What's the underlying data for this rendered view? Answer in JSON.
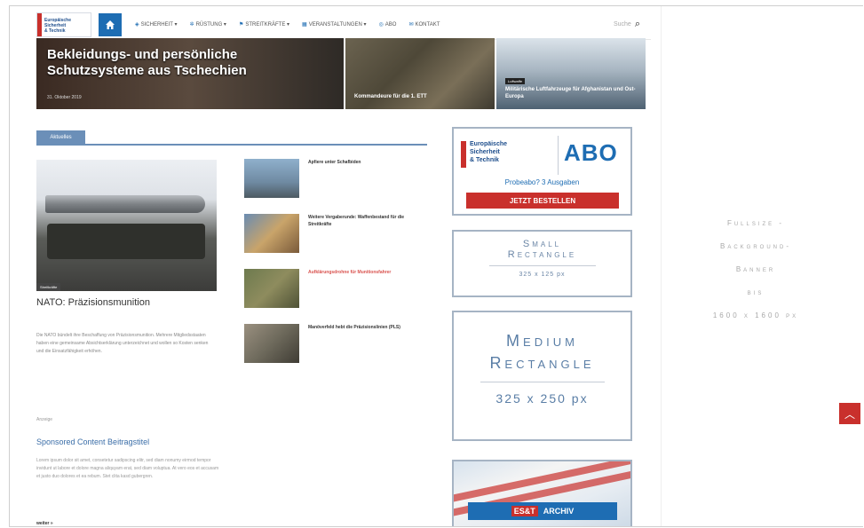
{
  "nav": {
    "logo_lines": [
      "Europäische",
      "Sicherheit",
      "& Technik"
    ],
    "items": [
      {
        "label": "Sicherheit",
        "icon": "shield-icon"
      },
      {
        "label": "Rüstung",
        "icon": "gear-icon"
      },
      {
        "label": "Streitkräfte",
        "icon": "flag-icon"
      },
      {
        "label": "Veranstaltungen",
        "icon": "calendar-icon"
      },
      {
        "label": "Abo",
        "icon": "cart-icon"
      },
      {
        "label": "Kontakt",
        "icon": "mail-icon"
      }
    ],
    "search_placeholder": "Suche"
  },
  "hero": {
    "main_title": "Bekleidungs- und persönliche Schutzsysteme aus Tschechien",
    "main_date": "31. Oktober 2019",
    "card1": {
      "tag": "",
      "label": "Kommandeure für die 1. ETT"
    },
    "card2": {
      "tag": "Luftwaffe",
      "label": "Militärische Luftfahrzeuge für Afghanistan und Ost-Europa"
    }
  },
  "section": {
    "tab_label": "Aktuelles"
  },
  "featured": {
    "badge": "Streitkräfte",
    "title": "NATO: Präzisionsmunition",
    "text": "Die NATO bündelt ihre Beschaffung von Präzisionsmunition. Mehrere Mitgliedsstaaten haben eine gemeinsame Absichtserklärung unterzeichnet und wollen so Kosten senken und die Einsatzfähigkeit erhöhen."
  },
  "side_items": [
    {
      "label": "Apfiere unter Schafbiden"
    },
    {
      "label": "Weitere Vergaberunde: Waffenbestand für die Streitkräfte"
    },
    {
      "label": "Aufklärungsdrohne für Munitionsfahrer"
    },
    {
      "label": "Manöverfeld hebt die Präzisionslinien (PLS)"
    }
  ],
  "sponsored": {
    "small_label": "Anzeige",
    "title": "Sponsored Content Beitragstitel",
    "text": "Lorem ipsum dolor sit amet, consetetur sadipscing elitr, sed diam nonumy eirmod tempor invidunt ut labore et dolore magna aliquyam erat, sed diam voluptua. At vero eos et accusam et justo duo dolores et ea rebum. Stet clita kasd gubergren.",
    "more": "weiter »"
  },
  "ads": {
    "abo": {
      "logo_lines": [
        "Europäische",
        "Sicherheit",
        "& Technik"
      ],
      "abo": "ABO",
      "probe": "Probeabo? 3 Ausgaben",
      "button": "JETZT BESTELLEN"
    },
    "small": {
      "l1": "Small",
      "l2": "Rectangle",
      "l3": "325 x 125 px"
    },
    "medium": {
      "l1": "Medium",
      "l2": "Rectangle",
      "l3": "325 x 250 px"
    },
    "archiv": {
      "esn": "ES&T",
      "label": "ARCHIV"
    }
  },
  "takeover": {
    "lines": [
      "Fullsize -",
      "Background-",
      "Banner",
      "bis",
      "1600 x 1600 px"
    ]
  },
  "colors": {
    "accent": "#1e6db3",
    "red": "#c9302c",
    "tab": "#6b8fb8"
  }
}
